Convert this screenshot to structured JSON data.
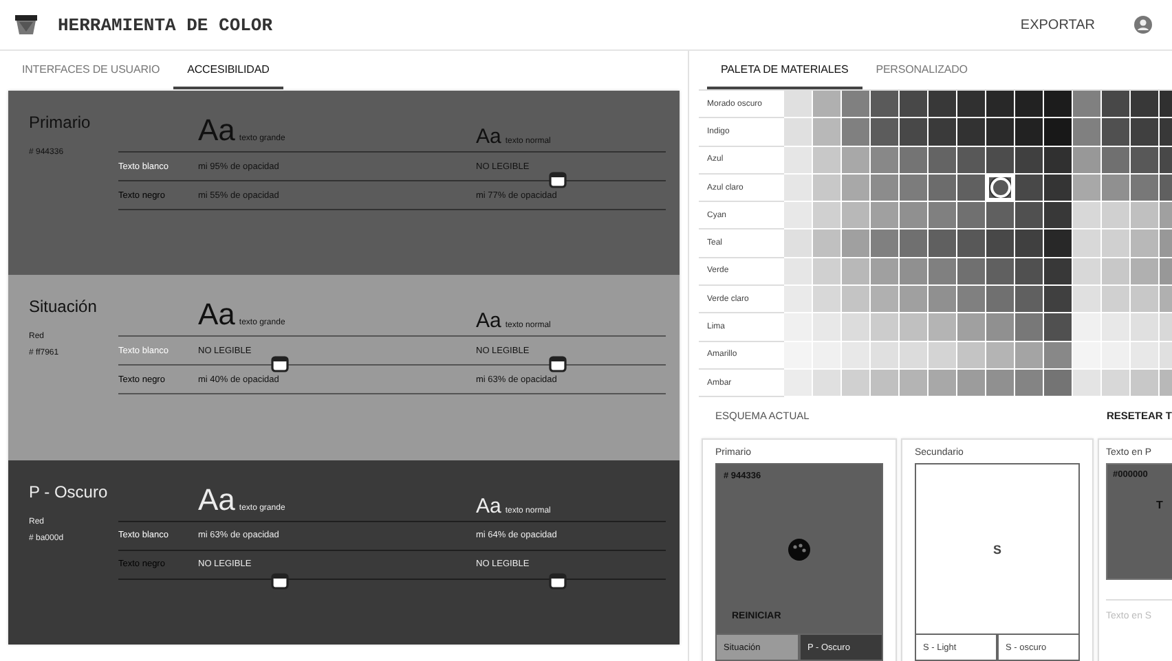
{
  "header": {
    "title": "HERRAMIENTA DE COLOR",
    "export": "EXPORTAR"
  },
  "left_tabs": [
    {
      "label": "INTERFACES DE USUARIO",
      "selected": false
    },
    {
      "label": "ACCESIBILIDAD",
      "selected": true
    }
  ],
  "sections": [
    {
      "title": "Primario",
      "hex": "# 944336",
      "color": "#5b5b5b",
      "large_sample": {
        "glyphs": "Aa",
        "label": "texto grande"
      },
      "normal_sample": {
        "glyphs": "Aa",
        "label": "texto normal"
      },
      "rows": [
        {
          "label": "Texto blanco",
          "kind": "white",
          "large": {
            "text": "mi 95% de opacidad"
          },
          "normal": {
            "text": "NO LEGIBLE"
          }
        },
        {
          "label": "Texto negro",
          "kind": "black",
          "large": {
            "text": "mi 55% de opacidad"
          },
          "normal": {
            "text": "mi 77% de opacidad",
            "handle_above": true
          }
        }
      ]
    },
    {
      "title": "Situación",
      "subtitle": "Red",
      "hex": "# ff7961",
      "color": "#9a9a9a",
      "large_sample": {
        "glyphs": "Aa",
        "label": "texto grande"
      },
      "normal_sample": {
        "glyphs": "Aa",
        "label": "texto normal"
      },
      "rows": [
        {
          "label": "Texto blanco",
          "kind": "white",
          "large": {
            "text": "NO LEGIBLE"
          },
          "normal": {
            "text": "NO LEGIBLE"
          }
        },
        {
          "label": "Texto negro",
          "kind": "black",
          "large": {
            "text": "mi 40% de opacidad",
            "handle_above": true
          },
          "normal": {
            "text": "mi 63% de opacidad",
            "handle_above": true
          }
        }
      ]
    },
    {
      "title": "P - Oscuro",
      "subtitle": "Red",
      "hex": "# ba000d",
      "color": "#3a3a3a",
      "large_sample": {
        "glyphs": "Aa",
        "label": "texto grande"
      },
      "normal_sample": {
        "glyphs": "Aa",
        "label": "texto normal"
      },
      "rows": [
        {
          "label": "Texto blanco",
          "kind": "white",
          "large": {
            "text": "mi 63% de opacidad"
          },
          "normal": {
            "text": "mi 64% de opacidad"
          }
        },
        {
          "label": "Texto negro",
          "kind": "black",
          "large": {
            "text": "NO LEGIBLE",
            "handle_below": true
          },
          "normal": {
            "text": "NO LEGIBLE",
            "handle_below": true
          }
        }
      ]
    }
  ],
  "right_tabs": [
    {
      "label": "PALETA DE MATERIALES",
      "selected": true
    },
    {
      "label": "PERSONALIZADO",
      "selected": false
    }
  ],
  "palette": [
    {
      "label": "Morado oscuro",
      "swatches": [
        {
          "color": "#e0e0e0",
          "selected": false
        },
        {
          "color": "#b0b0b0",
          "selected": false
        },
        {
          "color": "#808080",
          "selected": false
        },
        {
          "color": "#5a5a5a",
          "selected": false
        },
        {
          "color": "#484848",
          "selected": false
        },
        {
          "color": "#383838",
          "selected": false
        },
        {
          "color": "#303030",
          "selected": false
        },
        {
          "color": "#282828",
          "selected": false
        },
        {
          "color": "#222222",
          "selected": false
        },
        {
          "color": "#1c1c1c",
          "selected": false
        },
        {
          "color": "#808080",
          "selected": false
        },
        {
          "color": "#484848",
          "selected": false
        },
        {
          "color": "#383838",
          "selected": false
        },
        {
          "color": "#303030",
          "selected": false
        }
      ]
    },
    {
      "label": "Indigo",
      "swatches": [
        {
          "color": "#e0e0e0",
          "selected": false
        },
        {
          "color": "#b8b8b8",
          "selected": false
        },
        {
          "color": "#808080",
          "selected": false
        },
        {
          "color": "#5c5c5c",
          "selected": false
        },
        {
          "color": "#484848",
          "selected": false
        },
        {
          "color": "#3a3a3a",
          "selected": false
        },
        {
          "color": "#323232",
          "selected": false
        },
        {
          "color": "#2a2a2a",
          "selected": false
        },
        {
          "color": "#222222",
          "selected": false
        },
        {
          "color": "#181818",
          "selected": false
        },
        {
          "color": "#808080",
          "selected": false
        },
        {
          "color": "#505050",
          "selected": false
        },
        {
          "color": "#404040",
          "selected": false
        },
        {
          "color": "#383838",
          "selected": false
        }
      ]
    },
    {
      "label": "Azul",
      "swatches": [
        {
          "color": "#e6e6e6",
          "selected": false
        },
        {
          "color": "#c8c8c8",
          "selected": false
        },
        {
          "color": "#a8a8a8",
          "selected": false
        },
        {
          "color": "#888888",
          "selected": false
        },
        {
          "color": "#747474",
          "selected": false
        },
        {
          "color": "#646464",
          "selected": false
        },
        {
          "color": "#585858",
          "selected": false
        },
        {
          "color": "#4c4c4c",
          "selected": false
        },
        {
          "color": "#404040",
          "selected": false
        },
        {
          "color": "#303030",
          "selected": false
        },
        {
          "color": "#989898",
          "selected": false
        },
        {
          "color": "#707070",
          "selected": false
        },
        {
          "color": "#585858",
          "selected": false
        },
        {
          "color": "#484848",
          "selected": false
        }
      ]
    },
    {
      "label": "Azul claro",
      "swatches": [
        {
          "color": "#e6e6e6",
          "selected": false
        },
        {
          "color": "#c8c8c8",
          "selected": false
        },
        {
          "color": "#a8a8a8",
          "selected": false
        },
        {
          "color": "#8c8c8c",
          "selected": false
        },
        {
          "color": "#7c7c7c",
          "selected": false
        },
        {
          "color": "#6c6c6c",
          "selected": false
        },
        {
          "color": "#606060",
          "selected": false
        },
        {
          "color": "#585858",
          "selected": true
        },
        {
          "color": "#484848",
          "selected": false
        },
        {
          "color": "#343434",
          "selected": false
        },
        {
          "color": "#a8a8a8",
          "selected": false
        },
        {
          "color": "#909090",
          "selected": false
        },
        {
          "color": "#787878",
          "selected": false
        },
        {
          "color": "#606060",
          "selected": false
        }
      ]
    },
    {
      "label": "Cyan",
      "swatches": [
        {
          "color": "#e8e8e8",
          "selected": false
        },
        {
          "color": "#d0d0d0",
          "selected": false
        },
        {
          "color": "#b8b8b8",
          "selected": false
        },
        {
          "color": "#a0a0a0",
          "selected": false
        },
        {
          "color": "#909090",
          "selected": false
        },
        {
          "color": "#808080",
          "selected": false
        },
        {
          "color": "#707070",
          "selected": false
        },
        {
          "color": "#606060",
          "selected": false
        },
        {
          "color": "#505050",
          "selected": false
        },
        {
          "color": "#383838",
          "selected": false
        },
        {
          "color": "#d8d8d8",
          "selected": false
        },
        {
          "color": "#d0d0d0",
          "selected": false
        },
        {
          "color": "#c0c0c0",
          "selected": false
        },
        {
          "color": "#a0a0a0",
          "selected": false
        }
      ]
    },
    {
      "label": "Teal",
      "swatches": [
        {
          "color": "#e0e0e0",
          "selected": false
        },
        {
          "color": "#c0c0c0",
          "selected": false
        },
        {
          "color": "#a0a0a0",
          "selected": false
        },
        {
          "color": "#808080",
          "selected": false
        },
        {
          "color": "#707070",
          "selected": false
        },
        {
          "color": "#606060",
          "selected": false
        },
        {
          "color": "#585858",
          "selected": false
        },
        {
          "color": "#484848",
          "selected": false
        },
        {
          "color": "#404040",
          "selected": false
        },
        {
          "color": "#282828",
          "selected": false
        },
        {
          "color": "#d8d8d8",
          "selected": false
        },
        {
          "color": "#d0d0d0",
          "selected": false
        },
        {
          "color": "#b8b8b8",
          "selected": false
        },
        {
          "color": "#989898",
          "selected": false
        }
      ]
    },
    {
      "label": "Verde",
      "swatches": [
        {
          "color": "#e6e6e6",
          "selected": false
        },
        {
          "color": "#d0d0d0",
          "selected": false
        },
        {
          "color": "#b8b8b8",
          "selected": false
        },
        {
          "color": "#a0a0a0",
          "selected": false
        },
        {
          "color": "#909090",
          "selected": false
        },
        {
          "color": "#808080",
          "selected": false
        },
        {
          "color": "#707070",
          "selected": false
        },
        {
          "color": "#606060",
          "selected": false
        },
        {
          "color": "#505050",
          "selected": false
        },
        {
          "color": "#383838",
          "selected": false
        },
        {
          "color": "#d8d8d8",
          "selected": false
        },
        {
          "color": "#c8c8c8",
          "selected": false
        },
        {
          "color": "#b0b0b0",
          "selected": false
        },
        {
          "color": "#989898",
          "selected": false
        }
      ]
    },
    {
      "label": "Verde claro",
      "swatches": [
        {
          "color": "#eaeaea",
          "selected": false
        },
        {
          "color": "#d8d8d8",
          "selected": false
        },
        {
          "color": "#c4c4c4",
          "selected": false
        },
        {
          "color": "#b0b0b0",
          "selected": false
        },
        {
          "color": "#a0a0a0",
          "selected": false
        },
        {
          "color": "#909090",
          "selected": false
        },
        {
          "color": "#808080",
          "selected": false
        },
        {
          "color": "#707070",
          "selected": false
        },
        {
          "color": "#606060",
          "selected": false
        },
        {
          "color": "#404040",
          "selected": false
        },
        {
          "color": "#e0e0e0",
          "selected": false
        },
        {
          "color": "#d0d0d0",
          "selected": false
        },
        {
          "color": "#c8c8c8",
          "selected": false
        },
        {
          "color": "#b0b0b0",
          "selected": false
        }
      ]
    },
    {
      "label": "Lima",
      "swatches": [
        {
          "color": "#f0f0f0",
          "selected": false
        },
        {
          "color": "#e8e8e8",
          "selected": false
        },
        {
          "color": "#dcdcdc",
          "selected": false
        },
        {
          "color": "#cccccc",
          "selected": false
        },
        {
          "color": "#c0c0c0",
          "selected": false
        },
        {
          "color": "#b4b4b4",
          "selected": false
        },
        {
          "color": "#a0a0a0",
          "selected": false
        },
        {
          "color": "#909090",
          "selected": false
        },
        {
          "color": "#787878",
          "selected": false
        },
        {
          "color": "#505050",
          "selected": false
        },
        {
          "color": "#f0f0f0",
          "selected": false
        },
        {
          "color": "#e8e8e8",
          "selected": false
        },
        {
          "color": "#e0e0e0",
          "selected": false
        },
        {
          "color": "#d8d8d8",
          "selected": false
        }
      ]
    },
    {
      "label": "Amarillo",
      "swatches": [
        {
          "color": "#f4f4f4",
          "selected": false
        },
        {
          "color": "#f0f0f0",
          "selected": false
        },
        {
          "color": "#e8e8e8",
          "selected": false
        },
        {
          "color": "#e0e0e0",
          "selected": false
        },
        {
          "color": "#dcdcdc",
          "selected": false
        },
        {
          "color": "#d4d4d4",
          "selected": false
        },
        {
          "color": "#c4c4c4",
          "selected": false
        },
        {
          "color": "#b4b4b4",
          "selected": false
        },
        {
          "color": "#a4a4a4",
          "selected": false
        },
        {
          "color": "#888888",
          "selected": false
        },
        {
          "color": "#f4f4f4",
          "selected": false
        },
        {
          "color": "#f0f0f0",
          "selected": false
        },
        {
          "color": "#e8e8e8",
          "selected": false
        },
        {
          "color": "#e0e0e0",
          "selected": false
        }
      ]
    },
    {
      "label": "Ambar",
      "swatches": [
        {
          "color": "#ececec",
          "selected": false
        },
        {
          "color": "#e0e0e0",
          "selected": false
        },
        {
          "color": "#d0d0d0",
          "selected": false
        },
        {
          "color": "#c0c0c0",
          "selected": false
        },
        {
          "color": "#b4b4b4",
          "selected": false
        },
        {
          "color": "#a8a8a8",
          "selected": false
        },
        {
          "color": "#9c9c9c",
          "selected": false
        },
        {
          "color": "#909090",
          "selected": false
        },
        {
          "color": "#848484",
          "selected": false
        },
        {
          "color": "#747474",
          "selected": false
        },
        {
          "color": "#e4e4e4",
          "selected": false
        },
        {
          "color": "#d8d8d8",
          "selected": false
        },
        {
          "color": "#c8c8c8",
          "selected": false
        },
        {
          "color": "#b8b8b8",
          "selected": false
        }
      ]
    }
  ],
  "scheme": {
    "title": "ESQUEMA ACTUAL",
    "reset": "RESETEAR T",
    "cards": [
      {
        "kind": "primary",
        "label": "Primario",
        "hex": "# 944336",
        "color": "#5e5e5e",
        "action": "REINICIAR",
        "variants": [
          {
            "label": "Situación",
            "color": "#9a9a9a"
          },
          {
            "label": "P - Oscuro",
            "color": "#3a3a3a"
          }
        ]
      },
      {
        "kind": "secondary",
        "label": "Secundario",
        "letter": "S",
        "color": "#ffffff",
        "variants": [
          {
            "label": "S - Light",
            "color": "#ffffff"
          },
          {
            "label": "S - oscuro",
            "color": "#ffffff"
          }
        ]
      },
      {
        "kind": "text",
        "label": "Texto en P",
        "hex": "#000000",
        "letter": "T",
        "color": "#5e5e5e",
        "secondary_label": "Texto en S"
      }
    ]
  }
}
